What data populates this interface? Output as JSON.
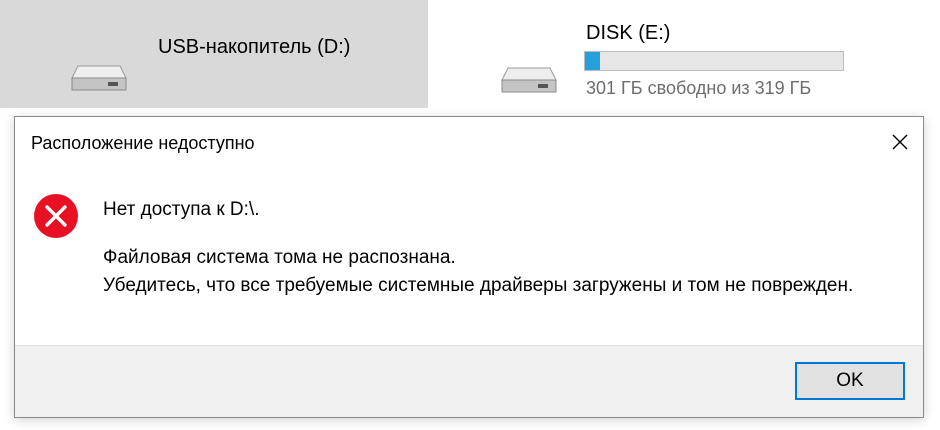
{
  "explorer": {
    "drives": [
      {
        "name": "USB-накопитель (D:)",
        "icon": "usb-drive-icon",
        "selected": true
      },
      {
        "name": "DISK (E:)",
        "icon": "hard-drive-icon",
        "selected": false,
        "usage_fraction": 0.06,
        "free_space_text": "301 ГБ свободно из 319 ГБ"
      }
    ],
    "colors": {
      "selected_tile": "#d9d9d9",
      "capacity_fill": "#26a0da"
    }
  },
  "dialog": {
    "title": "Расположение недоступно",
    "close_icon": "close-icon",
    "error_icon": "error-icon",
    "heading": "Нет доступа к D:\\.",
    "lines": [
      "Файловая система тома не распознана.",
      "Убедитесь, что все требуемые системные драйверы загружены и том не поврежден."
    ],
    "ok_label": "OK",
    "colors": {
      "error_red": "#e81123",
      "button_focus": "#0078d7"
    }
  }
}
